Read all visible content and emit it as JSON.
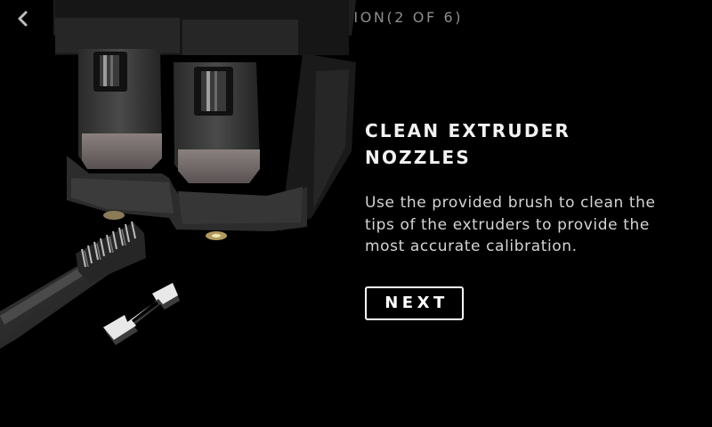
{
  "header": {
    "title": "CALIBRATION(2 OF 6)",
    "back_icon": "chevron-left-icon"
  },
  "step": {
    "headline": "CLEAN EXTRUDER NOZZLES",
    "description": "Use the provided brush to clean the tips of the extruders to provide the most accurate calibration.",
    "next_label": "NEXT"
  },
  "illustration": {
    "icon": "extruder-cleaning-illustration"
  },
  "colors": {
    "background": "#000000",
    "title": "#8d8d8d",
    "text": "#ffffff"
  }
}
